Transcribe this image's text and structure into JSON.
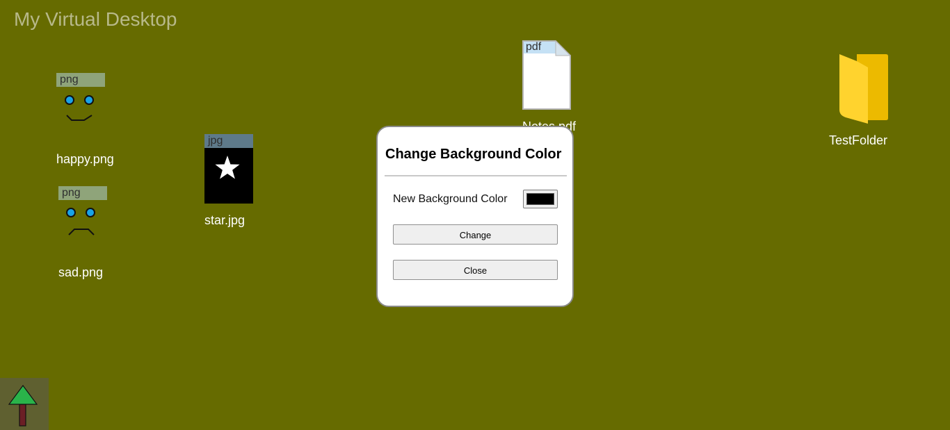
{
  "desktop": {
    "title": "My Virtual Desktop",
    "background_color": "#666b00"
  },
  "icons": [
    {
      "name": "happy.png",
      "type_tag": "png",
      "kind": "happy-face"
    },
    {
      "name": "sad.png",
      "type_tag": "png",
      "kind": "sad-face"
    },
    {
      "name": "star.jpg",
      "type_tag": "jpg",
      "kind": "star-image"
    },
    {
      "name": "Notes.pdf",
      "type_tag": "pdf",
      "kind": "pdf-document"
    },
    {
      "name": "TestFolder",
      "type_tag": "",
      "kind": "folder"
    }
  ],
  "dialog": {
    "title": "Change Background Color",
    "color_label": "New Background Color",
    "color_value": "#000000",
    "change_label": "Change",
    "close_label": "Close"
  },
  "taskbar": {
    "start_icon": "tree-icon"
  }
}
